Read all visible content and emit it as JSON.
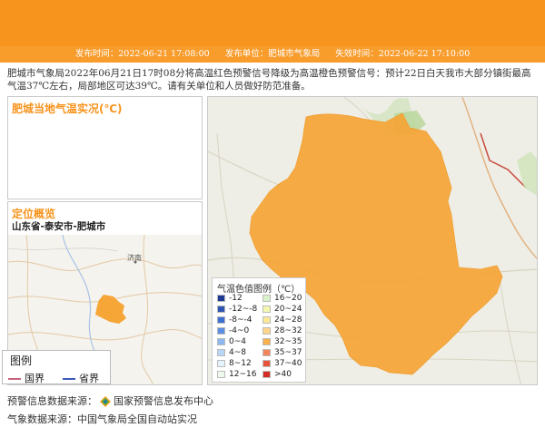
{
  "meta": {
    "issue_time": "发布时间：2022-06-21 17:08:00",
    "issuer": "发布单位：肥城市气象局",
    "expire_time": "失效时间：2022-06-22 17:10:00"
  },
  "notice_text": "肥城市气象局2022年06月21日17时08分将高温红色预警信号降级为高温橙色预警信号：预计22日白天我市大部分镇街最高气温37℃左右，局部地区可达39℃。请有关单位和人员做好防范准备。",
  "temp_panel": {
    "title": "肥城当地气温实况(℃)"
  },
  "location_panel": {
    "title": "定位概览",
    "subtitle": "山东省-泰安市-肥城市",
    "city_label": "济南"
  },
  "map_legend": {
    "title": "图例",
    "items": [
      {
        "label": "国界",
        "color": "#c8627b"
      },
      {
        "label": "省界",
        "color": "#3a59b8"
      }
    ]
  },
  "temperature_scale": {
    "title": "气温色值图例（℃）",
    "left": [
      {
        "label": "-12",
        "color": "#1f3a93"
      },
      {
        "label": "-12~-8",
        "color": "#2f55b3"
      },
      {
        "label": "-8~-4",
        "color": "#3d6fd0"
      },
      {
        "label": "-4~0",
        "color": "#5d8ee2"
      },
      {
        "label": "0~4",
        "color": "#8fb7ef"
      },
      {
        "label": "4~8",
        "color": "#b7d6f5"
      },
      {
        "label": "8~12",
        "color": "#e4f2fb"
      },
      {
        "label": "12~16",
        "color": "#effaef"
      }
    ],
    "right": [
      {
        "label": "16~20",
        "color": "#d8f1c9"
      },
      {
        "label": "20~24",
        "color": "#f4f6b0"
      },
      {
        "label": "24~28",
        "color": "#fbe99a"
      },
      {
        "label": "28~32",
        "color": "#fcd58a"
      },
      {
        "label": "32~35",
        "color": "#f9b04d"
      },
      {
        "label": "35~37",
        "color": "#f3855a"
      },
      {
        "label": "37~40",
        "color": "#e8543b"
      },
      {
        "label": ">40",
        "color": "#d52d23"
      }
    ]
  },
  "region_color": "#f6a537",
  "footer": {
    "warning_source": "预警信息数据来源：",
    "warning_org": "国家预警信息发布中心",
    "weather_source": "气象数据来源：中国气象局全国自动站实况"
  }
}
